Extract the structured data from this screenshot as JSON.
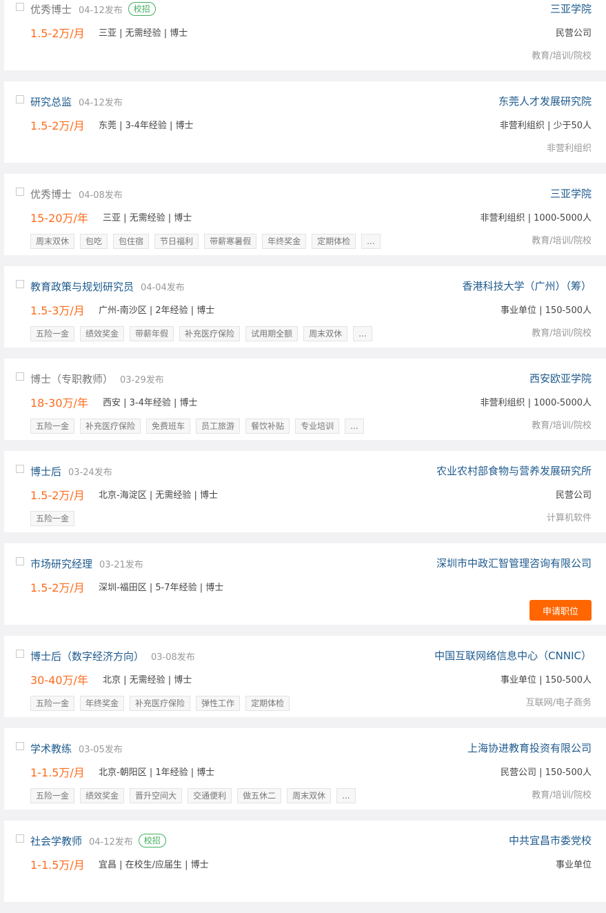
{
  "jobs": [
    {
      "title": "优秀博士",
      "date": "04-12发布",
      "badge": "校招",
      "salary": "1.5-2万/月",
      "meta": "三亚 | 无需经验 | 博士",
      "company": "三亚学院",
      "company_meta": "民营公司",
      "industry": "教育/培训/院校",
      "tags": [],
      "visited": true
    },
    {
      "title": "研究总监",
      "date": "04-12发布",
      "badge": "",
      "salary": "1.5-2万/月",
      "meta": "东莞 | 3-4年经验 | 博士",
      "company": "东莞人才发展研究院",
      "company_meta": "非营利组织 | 少于50人",
      "industry": "非营利组织",
      "tags": [],
      "visited": false
    },
    {
      "title": "优秀博士",
      "date": "04-08发布",
      "badge": "",
      "salary": "15-20万/年",
      "meta": "三亚 | 无需经验 | 博士",
      "company": "三亚学院",
      "company_meta": "非营利组织 | 1000-5000人",
      "industry": "教育/培训/院校",
      "tags": [
        "周末双休",
        "包吃",
        "包住宿",
        "节日福利",
        "带薪寒暑假",
        "年终奖金",
        "定期体检",
        "..."
      ],
      "visited": true
    },
    {
      "title": "教育政策与规划研究员",
      "date": "04-04发布",
      "badge": "",
      "salary": "1.5-3万/月",
      "meta": "广州-南沙区 | 2年经验 | 博士",
      "company": "香港科技大学（广州）（筹）",
      "company_meta": "事业单位 | 150-500人",
      "industry": "教育/培训/院校",
      "tags": [
        "五险一金",
        "绩效奖金",
        "带薪年假",
        "补充医疗保险",
        "试用期全额",
        "周末双休",
        "..."
      ],
      "visited": false
    },
    {
      "title": "博士（专职教师）",
      "date": "03-29发布",
      "badge": "",
      "salary": "18-30万/年",
      "meta": "西安 | 3-4年经验 | 博士",
      "company": "西安欧亚学院",
      "company_meta": "非营利组织 | 1000-5000人",
      "industry": "教育/培训/院校",
      "tags": [
        "五险一金",
        "补充医疗保险",
        "免费班车",
        "员工旅游",
        "餐饮补贴",
        "专业培训",
        "..."
      ],
      "visited": true
    },
    {
      "title": "博士后",
      "date": "03-24发布",
      "badge": "",
      "salary": "1.5-2万/月",
      "meta": "北京-海淀区 | 无需经验 | 博士",
      "company": "农业农村部食物与营养发展研究所",
      "company_meta": "民营公司",
      "industry": "计算机软件",
      "tags": [
        "五险一金"
      ],
      "visited": false
    },
    {
      "title": "市场研究经理",
      "date": "03-21发布",
      "badge": "",
      "salary": "1.5-2万/月",
      "meta": "深圳-福田区 | 5-7年经验 | 博士",
      "company": "深圳市中政汇智管理咨询有限公司",
      "company_meta": "",
      "industry": "",
      "tags": [],
      "visited": false,
      "apply_label": "申请职位"
    },
    {
      "title": "博士后（数字经济方向）",
      "date": "03-08发布",
      "badge": "",
      "salary": "30-40万/年",
      "meta": "北京 | 无需经验 | 博士",
      "company": "中国互联网络信息中心（CNNIC）",
      "company_meta": "事业单位 | 150-500人",
      "industry": "互联网/电子商务",
      "tags": [
        "五险一金",
        "年终奖金",
        "补充医疗保险",
        "弹性工作",
        "定期体检"
      ],
      "visited": false
    },
    {
      "title": "学术教练",
      "date": "03-05发布",
      "badge": "",
      "salary": "1-1.5万/月",
      "meta": "北京-朝阳区 | 1年经验 | 博士",
      "company": "上海协进教育投资有限公司",
      "company_meta": "民营公司 | 150-500人",
      "industry": "教育/培训/院校",
      "tags": [
        "五险一金",
        "绩效奖金",
        "晋升空间大",
        "交通便利",
        "做五休二",
        "周末双休",
        "..."
      ],
      "visited": false
    },
    {
      "title": "社会学教师",
      "date": "04-12发布",
      "badge": "校招",
      "salary": "1-1.5万/月",
      "meta": "宜昌 | 在校生/应届生 | 博士",
      "company": "中共宜昌市委党校",
      "company_meta": "事业单位",
      "industry": "",
      "tags": [],
      "visited": false
    }
  ],
  "colors": {
    "salary": "#ff6b1a",
    "link": "#1e5a8d",
    "apply": "#ff6600",
    "badge": "#3fae5c"
  }
}
